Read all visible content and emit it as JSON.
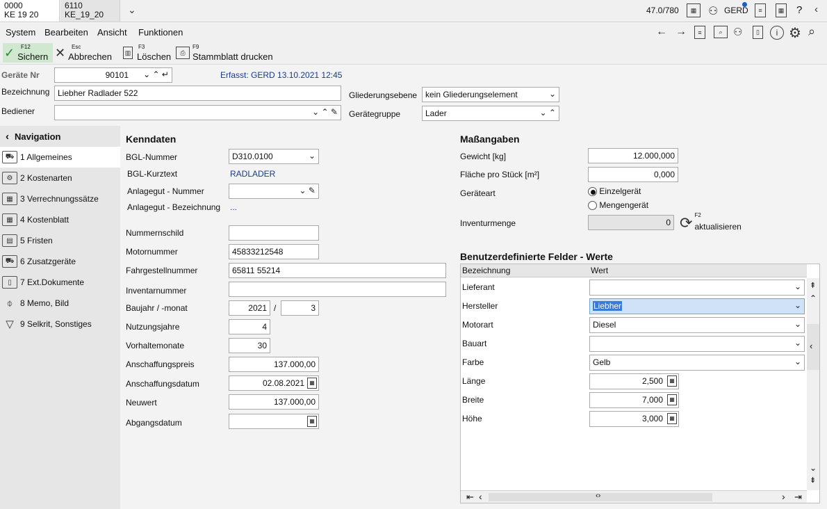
{
  "tabs": [
    {
      "line1": "0000",
      "line2": "KE 19 20"
    },
    {
      "line1": "6110",
      "line2": "KE_19_20"
    }
  ],
  "status": {
    "counter": "47.0/780",
    "user": "GERD",
    "help": "?"
  },
  "menu": [
    "System",
    "Bearbeiten",
    "Ansicht",
    "Funktionen"
  ],
  "toolbar": {
    "save": {
      "key": "F12",
      "label": "Sichern"
    },
    "cancel": {
      "key": "Esc",
      "label": "Abbrechen"
    },
    "delete": {
      "key": "F3",
      "label": "Löschen"
    },
    "print": {
      "key": "F9",
      "label": "Stammblatt drucken"
    }
  },
  "header": {
    "geraete_nr_label": "Geräte Nr",
    "geraete_nr": "90101",
    "erfasst": "Erfasst: GERD 13.10.2021 12:45",
    "bezeichnung_label": "Bezeichnung",
    "bezeichnung": "Liebher Radlader 522",
    "bediener_label": "Bediener",
    "bediener": "",
    "gliederung_label": "Gliederungsebene",
    "gliederung": "kein Gliederungselement",
    "geraetegruppe_label": "Gerätegruppe",
    "geraetegruppe": "Lader"
  },
  "nav": {
    "title": "Navigation",
    "items": [
      {
        "label": "1 Allgemeines",
        "icon": "excavator-icon"
      },
      {
        "label": "2 Kostenarten",
        "icon": "gears-icon"
      },
      {
        "label": "3 Verrechnungssätze",
        "icon": "calculator-icon"
      },
      {
        "label": "4 Kostenblatt",
        "icon": "table-icon"
      },
      {
        "label": "5 Fristen",
        "icon": "calendar-icon"
      },
      {
        "label": "6 Zusatzgeräte",
        "icon": "excavator-plus-icon"
      },
      {
        "label": "7 Ext.Dokumente",
        "icon": "document-icon"
      },
      {
        "label": "8 Memo, Bild",
        "icon": "paperclip-icon"
      },
      {
        "label": "9 Selkrit, Sonstiges",
        "icon": "filter-icon"
      }
    ]
  },
  "kenndaten": {
    "title": "Kenndaten",
    "bgl_nummer_label": "BGL-Nummer",
    "bgl_nummer": "D310.0100",
    "bgl_kurztext_label": "BGL-Kurztext",
    "bgl_kurztext": "RADLADER",
    "anlagegut_nr_label": "Anlagegut - Nummer",
    "anlagegut_nr": "",
    "anlagegut_bez_label": "Anlagegut - Bezeichnung",
    "anlagegut_bez": "...",
    "nummernschild_label": "Nummernschild",
    "nummernschild": "",
    "motornummer_label": "Motornummer",
    "motornummer": "45833212548",
    "fahrgestell_label": "Fahrgestellnummer",
    "fahrgestell": "65811 55214",
    "inventar_label": "Inventarnummer",
    "inventar": "",
    "baujahr_label": "Baujahr / -monat",
    "baujahr": "2021",
    "baujahr_sep": "/",
    "baumonat": "3",
    "nutzungsjahre_label": "Nutzungsjahre",
    "nutzungsjahre": "4",
    "vorhaltemonate_label": "Vorhaltemonate",
    "vorhaltemonate": "30",
    "anschaffungspreis_label": "Anschaffungspreis",
    "anschaffungspreis": "137.000,00",
    "anschaffungsdatum_label": "Anschaffungsdatum",
    "anschaffungsdatum": "02.08.2021",
    "neuwert_label": "Neuwert",
    "neuwert": "137.000,00",
    "abgangsdatum_label": "Abgangsdatum",
    "abgangsdatum": ""
  },
  "massangaben": {
    "title": "Maßangaben",
    "gewicht_label": "Gewicht [kg]",
    "gewicht": "12.000,000",
    "flaeche_label": "Fläche pro Stück [m²]",
    "flaeche": "0,000",
    "geraeteart_label": "Geräteart",
    "einzel": "Einzelgerät",
    "menge": "Mengengerät",
    "inventurmenge_label": "Inventurmenge",
    "inventurmenge": "0",
    "refresh_key": "F2",
    "refresh_label": "aktualisieren"
  },
  "custom": {
    "title": "Benutzerdefinierte Felder - Werte",
    "col_bez": "Bezeichnung",
    "col_wert": "Wert",
    "rows": [
      {
        "label": "Lieferant",
        "value": ""
      },
      {
        "label": "Hersteller",
        "value": "Liebher"
      },
      {
        "label": "Motorart",
        "value": "Diesel"
      },
      {
        "label": "Bauart",
        "value": ""
      },
      {
        "label": "Farbe",
        "value": "Gelb"
      },
      {
        "label": "Länge",
        "value": "2,500"
      },
      {
        "label": "Breite",
        "value": "7,000"
      },
      {
        "label": "Höhe",
        "value": "3,000"
      }
    ]
  }
}
